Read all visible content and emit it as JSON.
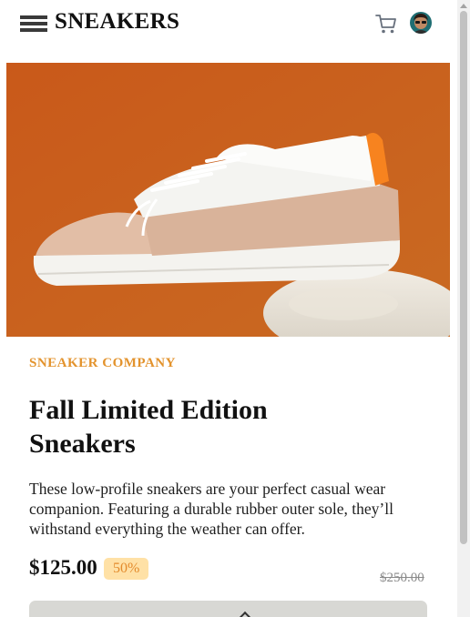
{
  "header": {
    "brand": "SNEAKERS",
    "icons": [
      "menu-icon",
      "cart-icon",
      "avatar"
    ]
  },
  "product": {
    "company": "SNEAKER COMPANY",
    "title": "Fall Limited Edition Sneakers",
    "description": "These low-profile sneakers are your perfect casual wear companion. Featuring a durable rubber outer sole, they’ll withstand everything the weather can offer.",
    "price": "$125.00",
    "discount": "50%",
    "original_price": "$250.00"
  },
  "colors": {
    "accent": "#e3932d",
    "discount_bg": "#ffe1a6",
    "hero_bg": "#c8601d"
  }
}
